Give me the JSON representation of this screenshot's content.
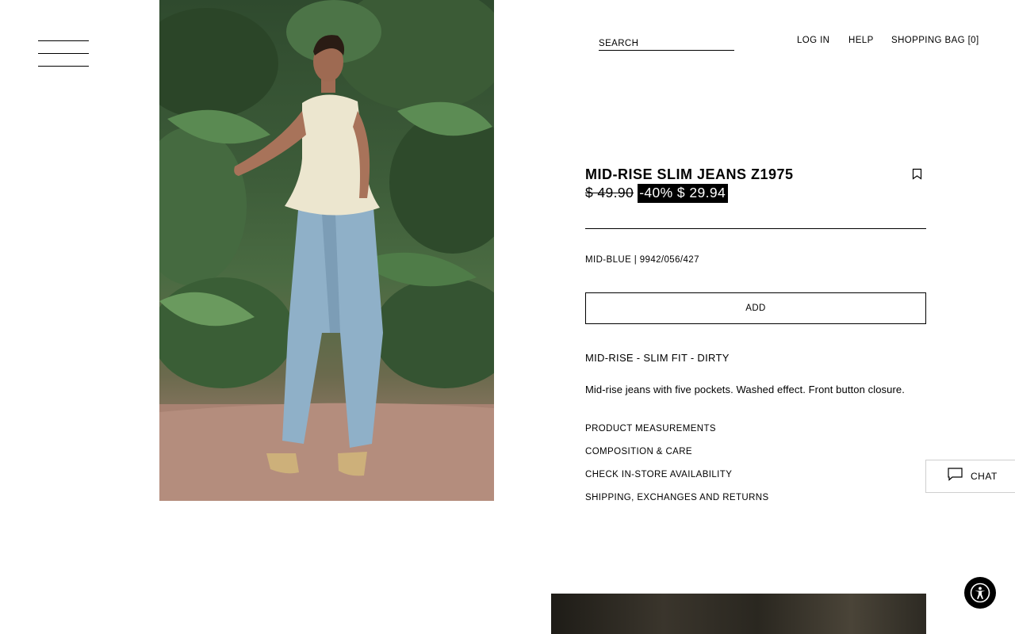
{
  "header": {
    "search_placeholder": "SEARCH",
    "login_label": "LOG IN",
    "help_label": "HELP",
    "bag_label": "SHOPPING BAG [0]"
  },
  "product": {
    "name": "MID-RISE SLIM JEANS Z1975",
    "old_price": "$ 49.90",
    "discount": "-40%",
    "new_price": "$ 29.94",
    "color_ref": "MID-BLUE | 9942/056/427",
    "add_label": "ADD",
    "subtitle": "MID-RISE - SLIM FIT - DIRTY",
    "description": "Mid-rise jeans with five pockets. Washed effect. Front button closure."
  },
  "info_links": [
    "PRODUCT MEASUREMENTS",
    "COMPOSITION & CARE",
    "CHECK IN-STORE AVAILABILITY",
    "SHIPPING, EXCHANGES AND RETURNS"
  ],
  "chat": {
    "label": "CHAT",
    "icon": "chat-bubble-icon"
  },
  "icons": {
    "menu": "hamburger-menu-icon",
    "bookmark": "bookmark-icon",
    "accessibility": "accessibility-icon"
  },
  "colors": {
    "text": "#000000",
    "background": "#ffffff",
    "price_tag_bg": "#000000",
    "price_tag_text": "#ffffff"
  }
}
